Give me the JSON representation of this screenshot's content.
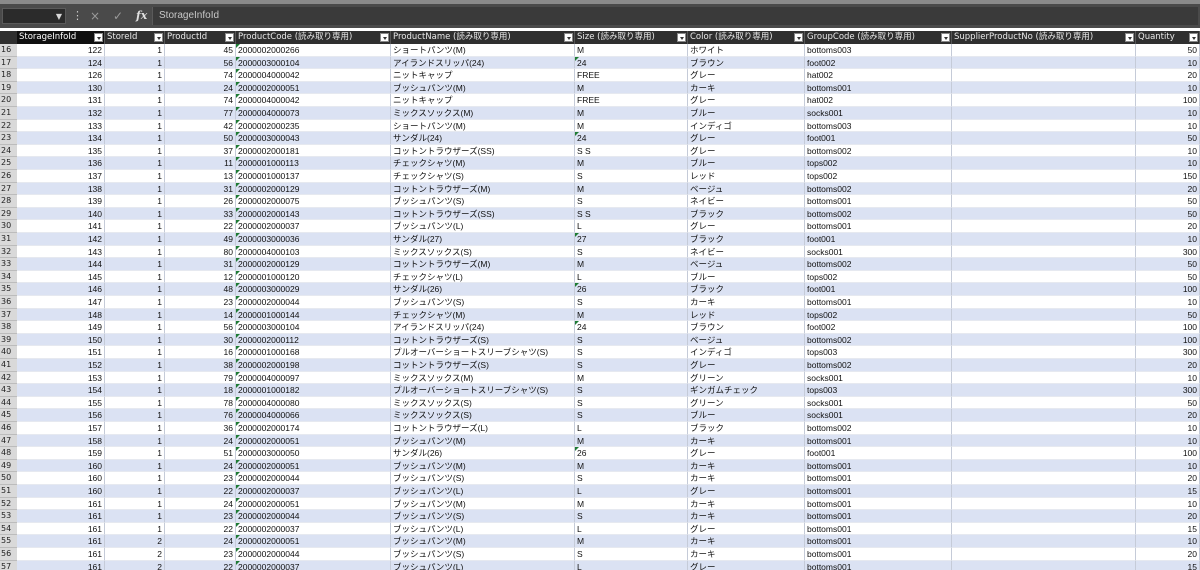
{
  "formula_bar": {
    "name_box_value": "",
    "cancel_icon": "×",
    "enter_icon": "✓",
    "fx_label": "fx",
    "content": "StorageInfoId"
  },
  "columns": [
    {
      "key": "storage",
      "label": "StorageInfoId",
      "align": "num"
    },
    {
      "key": "store",
      "label": "StoreId",
      "align": "num"
    },
    {
      "key": "product",
      "label": "ProductId",
      "align": "num"
    },
    {
      "key": "code",
      "label": "ProductCode (読み取り専用)",
      "align": "txt"
    },
    {
      "key": "name",
      "label": "ProductName (読み取り専用)",
      "align": "txt"
    },
    {
      "key": "size",
      "label": "Size (読み取り専用)",
      "align": "txt"
    },
    {
      "key": "color",
      "label": "Color (読み取り専用)",
      "align": "txt"
    },
    {
      "key": "group",
      "label": "GroupCode (読み取り専用)",
      "align": "txt"
    },
    {
      "key": "supplier",
      "label": "SupplierProductNo (読み取り専用)",
      "align": "txt"
    },
    {
      "key": "qty",
      "label": "Quantity",
      "align": "num"
    }
  ],
  "rows": [
    {
      "n": "16",
      "storage": "122",
      "store": "1",
      "product": "45",
      "code": "2000002000266",
      "name": "ショートパンツ(M)",
      "size": "M",
      "color": "ホワイト",
      "group": "bottoms003",
      "supplier": "",
      "qty": "50"
    },
    {
      "n": "17",
      "storage": "124",
      "store": "1",
      "product": "56",
      "code": "2000003000104",
      "name": "アイランドスリッパ(24)",
      "size": "24",
      "color": "ブラウン",
      "group": "foot002",
      "supplier": "",
      "qty": "10"
    },
    {
      "n": "18",
      "storage": "126",
      "store": "1",
      "product": "74",
      "code": "2000004000042",
      "name": "ニットキャップ",
      "size": "FREE",
      "color": "グレー",
      "group": "hat002",
      "supplier": "",
      "qty": "20"
    },
    {
      "n": "19",
      "storage": "130",
      "store": "1",
      "product": "24",
      "code": "2000002000051",
      "name": "ブッシュパンツ(M)",
      "size": "M",
      "color": "カーキ",
      "group": "bottoms001",
      "supplier": "",
      "qty": "10"
    },
    {
      "n": "20",
      "storage": "131",
      "store": "1",
      "product": "74",
      "code": "2000004000042",
      "name": "ニットキャップ",
      "size": "FREE",
      "color": "グレー",
      "group": "hat002",
      "supplier": "",
      "qty": "100"
    },
    {
      "n": "21",
      "storage": "132",
      "store": "1",
      "product": "77",
      "code": "2000004000073",
      "name": "ミックスソックス(M)",
      "size": "M",
      "color": "ブルー",
      "group": "socks001",
      "supplier": "",
      "qty": "10"
    },
    {
      "n": "22",
      "storage": "133",
      "store": "1",
      "product": "42",
      "code": "2000002000235",
      "name": "ショートパンツ(M)",
      "size": "M",
      "color": "インディゴ",
      "group": "bottoms003",
      "supplier": "",
      "qty": "10"
    },
    {
      "n": "23",
      "storage": "134",
      "store": "1",
      "product": "50",
      "code": "2000003000043",
      "name": "サンダル(24)",
      "size": "24",
      "color": "グレー",
      "group": "foot001",
      "supplier": "",
      "qty": "50"
    },
    {
      "n": "24",
      "storage": "135",
      "store": "1",
      "product": "37",
      "code": "2000002000181",
      "name": "コットントラウザーズ(SS)",
      "size": "S S",
      "color": "グレー",
      "group": "bottoms002",
      "supplier": "",
      "qty": "10"
    },
    {
      "n": "25",
      "storage": "136",
      "store": "1",
      "product": "11",
      "code": "2000001000113",
      "name": "チェックシャツ(M)",
      "size": "M",
      "color": "ブルー",
      "group": "tops002",
      "supplier": "",
      "qty": "10"
    },
    {
      "n": "26",
      "storage": "137",
      "store": "1",
      "product": "13",
      "code": "2000001000137",
      "name": "チェックシャツ(S)",
      "size": "S",
      "color": "レッド",
      "group": "tops002",
      "supplier": "",
      "qty": "150"
    },
    {
      "n": "27",
      "storage": "138",
      "store": "1",
      "product": "31",
      "code": "2000002000129",
      "name": "コットントラウザーズ(M)",
      "size": "M",
      "color": "ベージュ",
      "group": "bottoms002",
      "supplier": "",
      "qty": "20"
    },
    {
      "n": "28",
      "storage": "139",
      "store": "1",
      "product": "26",
      "code": "2000002000075",
      "name": "ブッシュパンツ(S)",
      "size": "S",
      "color": "ネイビー",
      "group": "bottoms001",
      "supplier": "",
      "qty": "50"
    },
    {
      "n": "29",
      "storage": "140",
      "store": "1",
      "product": "33",
      "code": "2000002000143",
      "name": "コットントラウザーズ(SS)",
      "size": "S S",
      "color": "ブラック",
      "group": "bottoms002",
      "supplier": "",
      "qty": "50"
    },
    {
      "n": "30",
      "storage": "141",
      "store": "1",
      "product": "22",
      "code": "2000002000037",
      "name": "ブッシュパンツ(L)",
      "size": "L",
      "color": "グレー",
      "group": "bottoms001",
      "supplier": "",
      "qty": "20"
    },
    {
      "n": "31",
      "storage": "142",
      "store": "1",
      "product": "49",
      "code": "2000003000036",
      "name": "サンダル(27)",
      "size": "27",
      "color": "ブラック",
      "group": "foot001",
      "supplier": "",
      "qty": "10"
    },
    {
      "n": "32",
      "storage": "143",
      "store": "1",
      "product": "80",
      "code": "2000004000103",
      "name": "ミックスソックス(S)",
      "size": "S",
      "color": "ネイビー",
      "group": "socks001",
      "supplier": "",
      "qty": "300"
    },
    {
      "n": "33",
      "storage": "144",
      "store": "1",
      "product": "31",
      "code": "2000002000129",
      "name": "コットントラウザーズ(M)",
      "size": "M",
      "color": "ベージュ",
      "group": "bottoms002",
      "supplier": "",
      "qty": "50"
    },
    {
      "n": "34",
      "storage": "145",
      "store": "1",
      "product": "12",
      "code": "2000001000120",
      "name": "チェックシャツ(L)",
      "size": "L",
      "color": "ブルー",
      "group": "tops002",
      "supplier": "",
      "qty": "50"
    },
    {
      "n": "35",
      "storage": "146",
      "store": "1",
      "product": "48",
      "code": "2000003000029",
      "name": "サンダル(26)",
      "size": "26",
      "color": "ブラック",
      "group": "foot001",
      "supplier": "",
      "qty": "100"
    },
    {
      "n": "36",
      "storage": "147",
      "store": "1",
      "product": "23",
      "code": "2000002000044",
      "name": "ブッシュパンツ(S)",
      "size": "S",
      "color": "カーキ",
      "group": "bottoms001",
      "supplier": "",
      "qty": "10"
    },
    {
      "n": "37",
      "storage": "148",
      "store": "1",
      "product": "14",
      "code": "2000001000144",
      "name": "チェックシャツ(M)",
      "size": "M",
      "color": "レッド",
      "group": "tops002",
      "supplier": "",
      "qty": "50"
    },
    {
      "n": "38",
      "storage": "149",
      "store": "1",
      "product": "56",
      "code": "2000003000104",
      "name": "アイランドスリッパ(24)",
      "size": "24",
      "color": "ブラウン",
      "group": "foot002",
      "supplier": "",
      "qty": "100"
    },
    {
      "n": "39",
      "storage": "150",
      "store": "1",
      "product": "30",
      "code": "2000002000112",
      "name": "コットントラウザーズ(S)",
      "size": "S",
      "color": "ベージュ",
      "group": "bottoms002",
      "supplier": "",
      "qty": "100"
    },
    {
      "n": "40",
      "storage": "151",
      "store": "1",
      "product": "16",
      "code": "2000001000168",
      "name": "プルオーバーショートスリーブシャツ(S)",
      "size": "S",
      "color": "インディゴ",
      "group": "tops003",
      "supplier": "",
      "qty": "300"
    },
    {
      "n": "41",
      "storage": "152",
      "store": "1",
      "product": "38",
      "code": "2000002000198",
      "name": "コットントラウザーズ(S)",
      "size": "S",
      "color": "グレー",
      "group": "bottoms002",
      "supplier": "",
      "qty": "20"
    },
    {
      "n": "42",
      "storage": "153",
      "store": "1",
      "product": "79",
      "code": "2000004000097",
      "name": "ミックスソックス(M)",
      "size": "M",
      "color": "グリーン",
      "group": "socks001",
      "supplier": "",
      "qty": "10"
    },
    {
      "n": "43",
      "storage": "154",
      "store": "1",
      "product": "18",
      "code": "2000001000182",
      "name": "プルオーバーショートスリーブシャツ(S)",
      "size": "S",
      "color": "ギンガムチェック",
      "group": "tops003",
      "supplier": "",
      "qty": "300"
    },
    {
      "n": "44",
      "storage": "155",
      "store": "1",
      "product": "78",
      "code": "2000004000080",
      "name": "ミックスソックス(S)",
      "size": "S",
      "color": "グリーン",
      "group": "socks001",
      "supplier": "",
      "qty": "50"
    },
    {
      "n": "45",
      "storage": "156",
      "store": "1",
      "product": "76",
      "code": "2000004000066",
      "name": "ミックスソックス(S)",
      "size": "S",
      "color": "ブルー",
      "group": "socks001",
      "supplier": "",
      "qty": "20"
    },
    {
      "n": "46",
      "storage": "157",
      "store": "1",
      "product": "36",
      "code": "2000002000174",
      "name": "コットントラウザーズ(L)",
      "size": "L",
      "color": "ブラック",
      "group": "bottoms002",
      "supplier": "",
      "qty": "10"
    },
    {
      "n": "47",
      "storage": "158",
      "store": "1",
      "product": "24",
      "code": "2000002000051",
      "name": "ブッシュパンツ(M)",
      "size": "M",
      "color": "カーキ",
      "group": "bottoms001",
      "supplier": "",
      "qty": "10"
    },
    {
      "n": "48",
      "storage": "159",
      "store": "1",
      "product": "51",
      "code": "2000003000050",
      "name": "サンダル(26)",
      "size": "26",
      "color": "グレー",
      "group": "foot001",
      "supplier": "",
      "qty": "100"
    },
    {
      "n": "49",
      "storage": "160",
      "store": "1",
      "product": "24",
      "code": "2000002000051",
      "name": "ブッシュパンツ(M)",
      "size": "M",
      "color": "カーキ",
      "group": "bottoms001",
      "supplier": "",
      "qty": "10"
    },
    {
      "n": "50",
      "storage": "160",
      "store": "1",
      "product": "23",
      "code": "2000002000044",
      "name": "ブッシュパンツ(S)",
      "size": "S",
      "color": "カーキ",
      "group": "bottoms001",
      "supplier": "",
      "qty": "20"
    },
    {
      "n": "51",
      "storage": "160",
      "store": "1",
      "product": "22",
      "code": "2000002000037",
      "name": "ブッシュパンツ(L)",
      "size": "L",
      "color": "グレー",
      "group": "bottoms001",
      "supplier": "",
      "qty": "15"
    },
    {
      "n": "52",
      "storage": "161",
      "store": "1",
      "product": "24",
      "code": "2000002000051",
      "name": "ブッシュパンツ(M)",
      "size": "M",
      "color": "カーキ",
      "group": "bottoms001",
      "supplier": "",
      "qty": "10"
    },
    {
      "n": "53",
      "storage": "161",
      "store": "1",
      "product": "23",
      "code": "2000002000044",
      "name": "ブッシュパンツ(S)",
      "size": "S",
      "color": "カーキ",
      "group": "bottoms001",
      "supplier": "",
      "qty": "20"
    },
    {
      "n": "54",
      "storage": "161",
      "store": "1",
      "product": "22",
      "code": "2000002000037",
      "name": "ブッシュパンツ(L)",
      "size": "L",
      "color": "グレー",
      "group": "bottoms001",
      "supplier": "",
      "qty": "15"
    },
    {
      "n": "55",
      "storage": "161",
      "store": "2",
      "product": "24",
      "code": "2000002000051",
      "name": "ブッシュパンツ(M)",
      "size": "M",
      "color": "カーキ",
      "group": "bottoms001",
      "supplier": "",
      "qty": "10"
    },
    {
      "n": "56",
      "storage": "161",
      "store": "2",
      "product": "23",
      "code": "2000002000044",
      "name": "ブッシュパンツ(S)",
      "size": "S",
      "color": "カーキ",
      "group": "bottoms001",
      "supplier": "",
      "qty": "20"
    },
    {
      "n": "57",
      "storage": "161",
      "store": "2",
      "product": "22",
      "code": "2000002000037",
      "name": "ブッシュパンツ(L)",
      "size": "L",
      "color": "グレー",
      "group": "bottoms001",
      "supplier": "",
      "qty": "15"
    }
  ],
  "theme": {
    "band_color": "#dbe2f3",
    "header_bg": "#2f2f2f",
    "formula_bar_bg": "#4a4a4a"
  }
}
